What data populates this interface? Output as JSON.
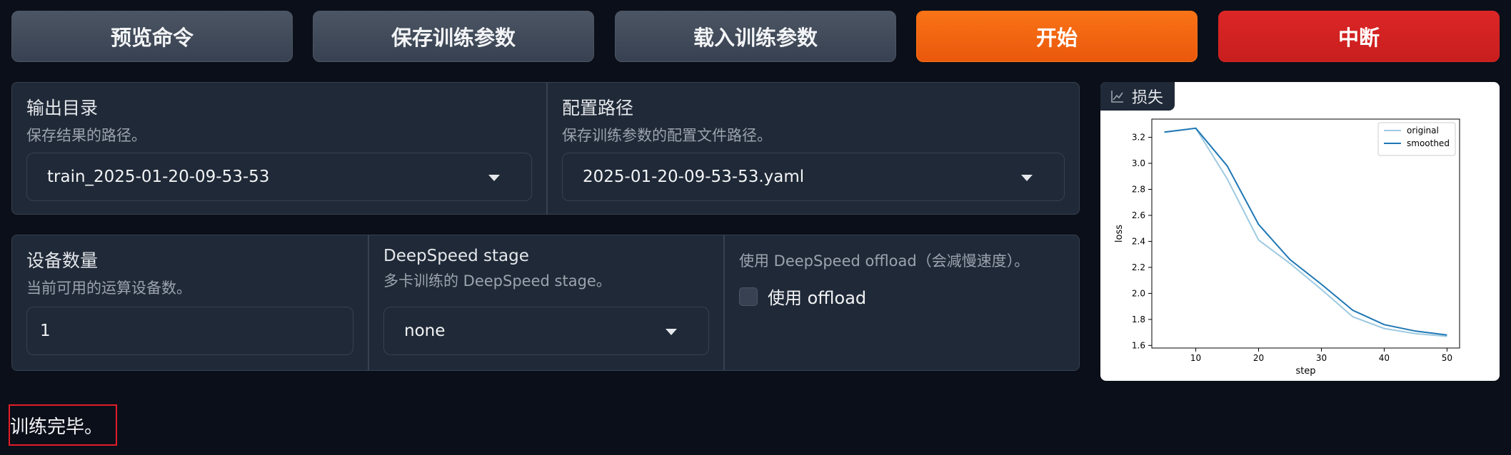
{
  "toolbar": {
    "preview_label": "预览命令",
    "save_label": "保存训练参数",
    "load_label": "载入训练参数",
    "start_label": "开始",
    "stop_label": "中断"
  },
  "output": {
    "output_dir": {
      "label": "输出目录",
      "info": "保存结果的路径。",
      "value": "train_2025-01-20-09-53-53"
    },
    "config_path": {
      "label": "配置路径",
      "info": "保存训练参数的配置文件路径。",
      "value": "2025-01-20-09-53-53.yaml"
    }
  },
  "devices": {
    "device_count": {
      "label": "设备数量",
      "info": "当前可用的运算设备数。",
      "value": "1"
    },
    "ds_stage": {
      "label": "DeepSpeed stage",
      "info": "多卡训练的 DeepSpeed stage。",
      "value": "none"
    },
    "ds_offload": {
      "info": "使用 DeepSpeed offload（会减慢速度）。",
      "label": "使用 offload",
      "checked": false
    }
  },
  "plot": {
    "tab_label": "损失",
    "icon": "chart-icon"
  },
  "chart_data": {
    "type": "line",
    "xlabel": "step",
    "ylabel": "loss",
    "xlim": [
      3,
      52
    ],
    "ylim": [
      1.58,
      3.34
    ],
    "xticks": [
      10,
      20,
      30,
      40,
      50
    ],
    "yticks": [
      1.6,
      1.8,
      2.0,
      2.2,
      2.4,
      2.6,
      2.8,
      3.0,
      3.2
    ],
    "legend_position": "top-right",
    "series": [
      {
        "name": "original",
        "color": "#9ecae1",
        "x": [
          5,
          10,
          15,
          20,
          25,
          30,
          35,
          40,
          45,
          50
        ],
        "y": [
          3.24,
          3.27,
          2.88,
          2.41,
          2.23,
          2.03,
          1.82,
          1.73,
          1.69,
          1.67
        ]
      },
      {
        "name": "smoothed",
        "color": "#1f77b4",
        "x": [
          5,
          10,
          15,
          20,
          25,
          30,
          35,
          40,
          45,
          50
        ],
        "y": [
          3.24,
          3.27,
          2.98,
          2.53,
          2.26,
          2.07,
          1.87,
          1.76,
          1.71,
          1.68
        ]
      }
    ]
  },
  "status": {
    "text": "训练完毕。"
  }
}
